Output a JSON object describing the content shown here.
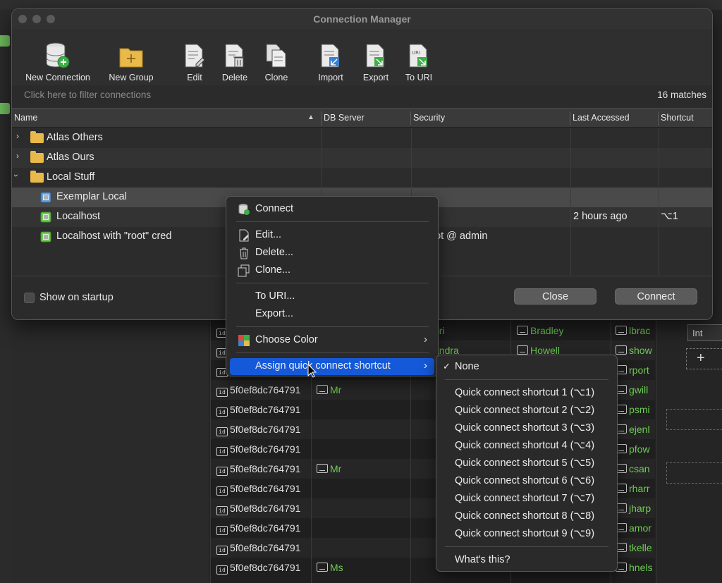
{
  "window": {
    "title": "Connection Manager"
  },
  "toolbar": {
    "new_connection": "New Connection",
    "new_group": "New Group",
    "edit": "Edit",
    "delete": "Delete",
    "clone": "Clone",
    "import": "Import",
    "export": "Export",
    "to_uri": "To URI"
  },
  "filter": {
    "placeholder": "Click here to filter connections",
    "matches": "16 matches"
  },
  "table": {
    "headers": {
      "name": "Name",
      "db_server": "DB Server",
      "security": "Security",
      "last_accessed": "Last Accessed",
      "shortcut": "Shortcut"
    },
    "rows": [
      {
        "name": "Atlas Others",
        "type": "group",
        "expanded": false
      },
      {
        "name": "Atlas Ours",
        "type": "group",
        "expanded": false
      },
      {
        "name": "Local Stuff",
        "type": "group",
        "expanded": true
      },
      {
        "name": "Exemplar Local",
        "type": "connection",
        "db_server": "",
        "security": "",
        "last_accessed": "",
        "shortcut": ""
      },
      {
        "name": "Localhost",
        "type": "connection",
        "db_server": "",
        "security": "",
        "last_accessed": "2 hours ago",
        "shortcut": "⌥1"
      },
      {
        "name": "Localhost with \"root\" cred",
        "type": "connection",
        "db_server": "",
        "security": "oot @ admin",
        "last_accessed": "",
        "shortcut": ""
      }
    ]
  },
  "footer": {
    "show_on_startup": "Show on startup",
    "close": "Close",
    "connect": "Connect"
  },
  "context_menu": {
    "connect": "Connect",
    "edit": "Edit...",
    "delete": "Delete...",
    "clone": "Clone...",
    "to_uri": "To URI...",
    "export": "Export...",
    "choose_color": "Choose Color",
    "assign_shortcut": "Assign quick connect shortcut"
  },
  "submenu": {
    "none": "None",
    "checkmark": "✓",
    "shortcuts": [
      "Quick connect shortcut 1 (⌥1)",
      "Quick connect shortcut 2 (⌥2)",
      "Quick connect shortcut 3 (⌥3)",
      "Quick connect shortcut 4 (⌥4)",
      "Quick connect shortcut 5 (⌥5)",
      "Quick connect shortcut 6 (⌥6)",
      "Quick connect shortcut 7 (⌥7)",
      "Quick connect shortcut 8 (⌥8)",
      "Quick connect shortcut 9 (⌥9)"
    ],
    "whats_this": "What's this?"
  },
  "background_grid": {
    "id_label": "id",
    "rows": [
      {
        "id": "5f0ef8dc764791",
        "title": "Mr",
        "col3": "",
        "col4": ""
      },
      {
        "id": "5f0ef8dc764791",
        "title": "",
        "col3": "",
        "col4": ""
      },
      {
        "id": "5f0ef8dc764791",
        "title": "",
        "col3": "",
        "col4": ""
      },
      {
        "id": "5f0ef8dc764791",
        "title": "",
        "col3": "",
        "col4": ""
      },
      {
        "id": "5f0ef8dc764791",
        "title": "Mr",
        "col3": "",
        "col4": ""
      },
      {
        "id": "5f0ef8dc764791",
        "title": "",
        "col3": "",
        "col4": ""
      },
      {
        "id": "5f0ef8dc764791",
        "title": "",
        "col3": "",
        "col4": ""
      },
      {
        "id": "5f0ef8dc764791",
        "title": "",
        "col3": "",
        "col4": ""
      },
      {
        "id": "5f0ef8dc764791",
        "title": "",
        "col3": "",
        "col4": ""
      },
      {
        "id": "5f0ef8dc764791",
        "title": "Ms",
        "col3": "",
        "col4": ""
      }
    ],
    "top_rows": [
      {
        "col3": "ori",
        "col4": "Bradley",
        "col5": "lbrac"
      },
      {
        "col3": "andra",
        "col4": "Howell",
        "col5": "show"
      }
    ],
    "right_col": [
      "rport",
      "gwill",
      "psmi",
      "ejenl",
      "pfow",
      "csan",
      "rharr",
      "jharp",
      "amor",
      "tkelle",
      "hnels"
    ],
    "side_label": "Int"
  },
  "colors": {
    "accent": "#1559d8",
    "folder": "#e9b949",
    "green": "#6fcc52"
  }
}
